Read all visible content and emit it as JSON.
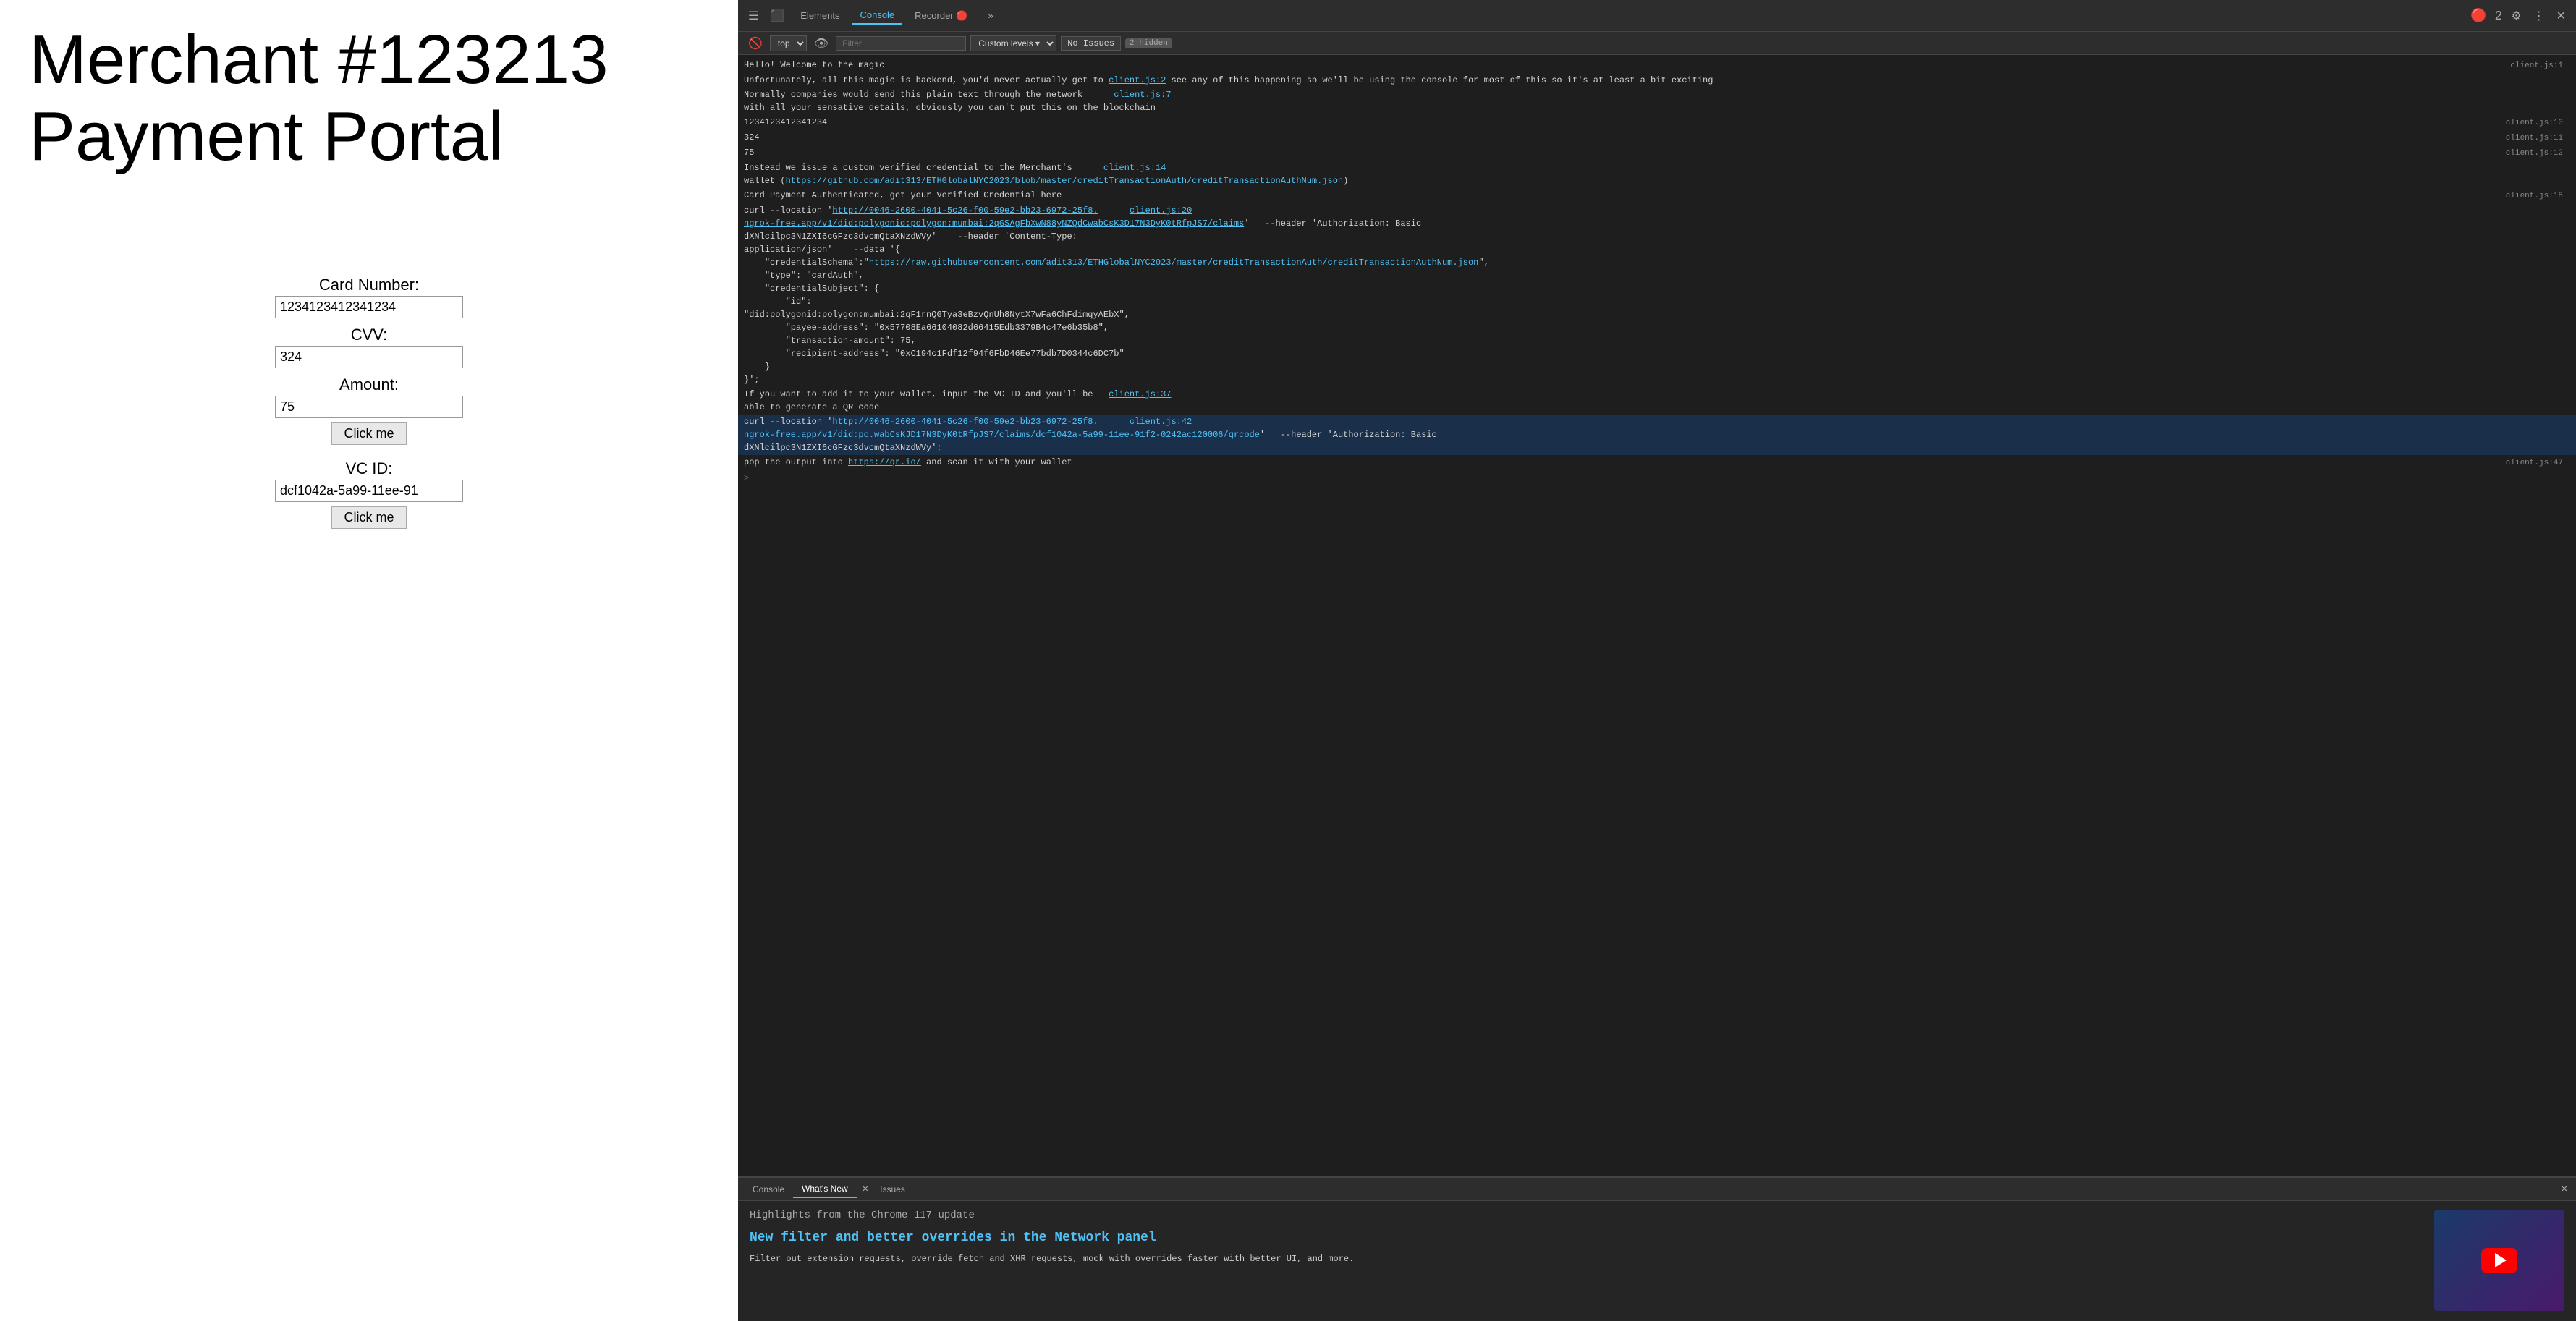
{
  "portal": {
    "title": "Merchant #123213 Payment Portal",
    "form": {
      "card_label": "Card Number:",
      "card_value": "1234123412341234",
      "cvv_label": "CVV:",
      "cvv_value": "324",
      "amount_label": "Amount:",
      "amount_value": "75",
      "submit_btn": "Click me",
      "vcid_label": "VC ID:",
      "vcid_value": "dcf1042a-5a99-11ee-91",
      "vcid_btn": "Click me"
    }
  },
  "devtools": {
    "tabs": [
      "Elements",
      "Console",
      "Recorder",
      "More"
    ],
    "active_tab": "Console",
    "top_dropdown": "top",
    "filter_placeholder": "Filter",
    "custom_levels": "Custom levels ▾",
    "no_issues": "No Issues",
    "hidden_count": "2 hidden",
    "console_lines": [
      {
        "text": "Hello! Welcome to the magic",
        "ref": "client.js:1",
        "type": "normal"
      },
      {
        "text": "Unfortunately, all this magic is backend, you'd never actually get to client.js:2 see any of this happening so we'll be using the console for most of this so it's at least a bit exciting",
        "ref": "",
        "type": "normal"
      },
      {
        "text": "Normally companies would send this plain text through the network     client.js:7 with all your sensative details, obviously you can't put this on the blockchain",
        "ref": "",
        "type": "normal"
      },
      {
        "text": "1234123412341234",
        "ref": "client.js:10",
        "type": "normal"
      },
      {
        "text": "324",
        "ref": "client.js:11",
        "type": "normal"
      },
      {
        "text": "75",
        "ref": "client.js:12",
        "type": "normal"
      },
      {
        "text": "Instead we issue a custom verified credential to the Merchant's     client.js:14 wallet (https://github.com/adit313/ETHGlobalNYC2023/blob/master/creditTransactionAuth/creditTransactionAuthNum.json)",
        "ref": "",
        "type": "link"
      },
      {
        "text": "Card Payment Authenticated, get your Verified Credential here",
        "ref": "client.js:18",
        "type": "normal"
      },
      {
        "text": "curl --location 'http://0046-2600-4041-5c26-f00-59e2-bb23-6972-25f8.  client.js:20 ngrok-free.app/v1/did:polygonid:polygon:mumbai:2qGSAgFbXwN88yNZQdCwabCsK3D17N3DyK0tRfpJS7/claims'   --header 'Authorization: Basic dXNlcilpc3N1ZXI6cGFzc3dvcmQtaXNzdWVy'    --header 'Content-Type: application/json'    --data '{ \"credentialSchema\":\"https://raw.githubusercontent.com/adit313/ETHGlobalNYC2023/master/creditTransactionAuth/creditTransactionAuthNum.json\", \"type\": \"cardAuth\", \"credentialSubject\": { \"id\": \"did:polygonid:polygon:mumbai:2qF1rnQGTya3eBzvQnUh8NytX7wFa6ChFdimqyAEbX\", \"payee-address\": \"0x57708Ea66104082d66415Edb3379B4c47e6b35b8\", \"transaction-amount\": 75, \"recipient-address\": \"0xC194c1Fdf12f94f6FbD46Ee77bdb7D0344c6DC7b\" } }';",
        "ref": "",
        "type": "code"
      },
      {
        "text": "If you want to add it to your wallet, input the VC ID and you'll be  client.js:37 able to generate a QR code",
        "ref": "",
        "type": "normal"
      },
      {
        "text": "curl --location 'http://0046-2600-4041-5c26-f00-59e2-bb23-6972-25f8.  client.js:42 ngrok-free.app/v1/did:po.wabCsKJD17N3DyK0tRfpJS7/claims/dcf1042a-5a99-11ee-91f2-0242ac120006/qrcode'   --header 'Authorization: Basic dXNlcilpc3N1ZXI6cGFzc3dvcmQtaXNzdWVy';",
        "ref": "",
        "type": "code-blue"
      },
      {
        "text": "pop the output into https://qr.io/ and scan it with your wallet",
        "ref": "client.js:47",
        "type": "link"
      }
    ],
    "bottom_tabs": [
      "Console",
      "What's New",
      "Issues"
    ],
    "whats_new": {
      "highlights": "Highlights from the Chrome 117 update",
      "feature_title": "New filter and better overrides in the Network panel",
      "description": "Filter out extension requests, override fetch and XHR requests, mock with overrides faster with better UI, and more."
    }
  }
}
